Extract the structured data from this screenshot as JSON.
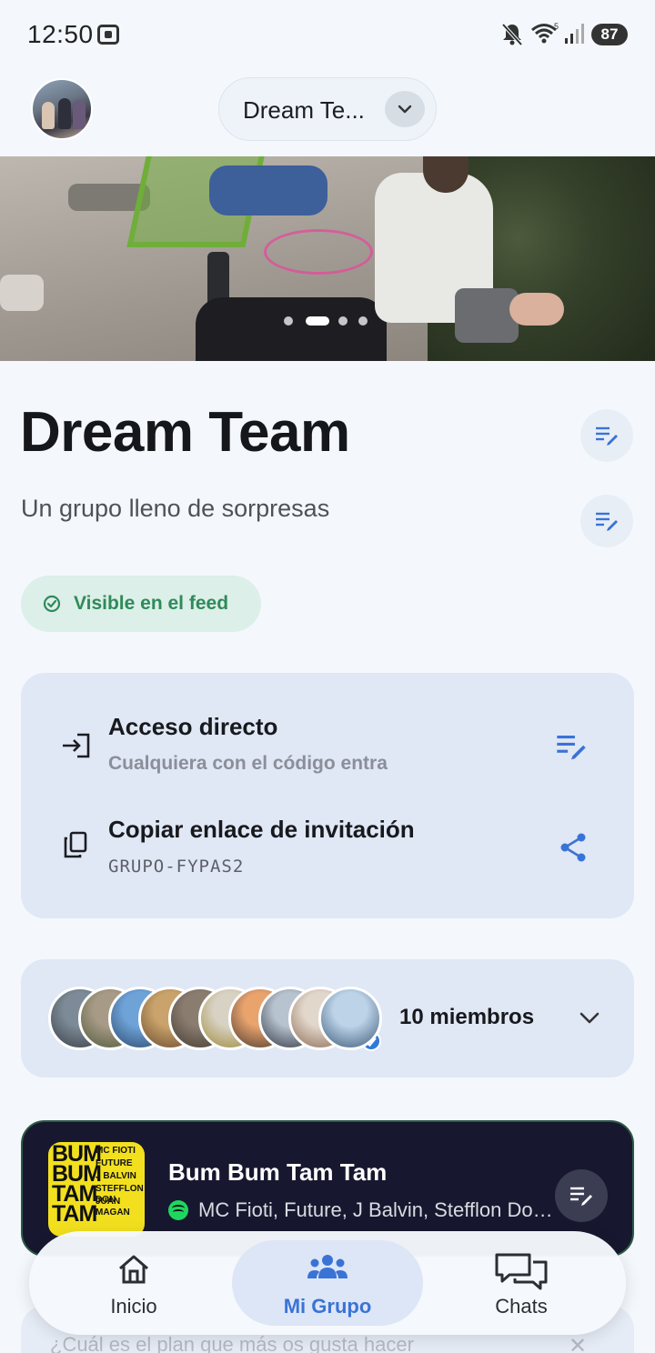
{
  "status_bar": {
    "time": "12:50",
    "battery": "87",
    "icons": [
      "screen-record-icon",
      "mute-icon",
      "wifi-icon",
      "signal-icon"
    ]
  },
  "header": {
    "group_selector_label": "Dream Te...",
    "avatar_icon": "group-photo-avatar",
    "chevron_icon": "chevron-down-icon"
  },
  "banner": {
    "slides_count": 4,
    "active_slide": 2
  },
  "group": {
    "title": "Dream Team",
    "subtitle": "Un grupo lleno de sorpresas",
    "feed_status": "Visible en el feed"
  },
  "access": {
    "direct_title": "Acceso directo",
    "direct_desc": "Cualquiera con el código entra",
    "invite_title": "Copiar enlace de invitación",
    "invite_code": "GRUPO-FYPAS2"
  },
  "members": {
    "count_label": "10 miembros",
    "avatars": [
      {
        "color_a": "#7c8b97",
        "color_b": "#3a3f47"
      },
      {
        "color_a": "#a79a86",
        "color_b": "#4f5a3a"
      },
      {
        "color_a": "#6fa3d8",
        "color_b": "#2b4a6e"
      },
      {
        "color_a": "#c9a36b",
        "color_b": "#6a4a2e"
      },
      {
        "color_a": "#8a7d70",
        "color_b": "#463b33"
      },
      {
        "color_a": "#d8d2c4",
        "color_b": "#9e8a3a"
      },
      {
        "color_a": "#e9a36d",
        "color_b": "#4a3a30"
      },
      {
        "color_a": "#b7c3cf",
        "color_b": "#2f3540"
      },
      {
        "color_a": "#e2d7cb",
        "color_b": "#8c6b55"
      },
      {
        "color_a": "#bcd3e8",
        "color_b": "#3e5a78"
      }
    ]
  },
  "song": {
    "title": "Bum Bum Tam Tam",
    "artists": "MC Fioti, Future, J Balvin, Stefflon Don, Juan Magan",
    "album_big": [
      "BUM",
      "BUM",
      "TAM",
      "TAM"
    ],
    "album_small": [
      "MC FIOTI",
      "FUTURE",
      "J BALVIN",
      "STEFFLON DON",
      "JUAN MAGAN"
    ]
  },
  "question": {
    "text": "¿Cuál es el plan que más os gusta hacer",
    "close": "✕"
  },
  "nav": {
    "items": [
      {
        "label": "Inicio",
        "icon": "home-icon"
      },
      {
        "label": "Mi Grupo",
        "icon": "group-icon"
      },
      {
        "label": "Chats",
        "icon": "chat-icon"
      }
    ],
    "active": "Mi Grupo"
  },
  "colors": {
    "accent": "#3a73d6",
    "feed_green": "#2f8a5a",
    "card_bg": "#e0e7f5",
    "song_bg": "#17182f"
  }
}
